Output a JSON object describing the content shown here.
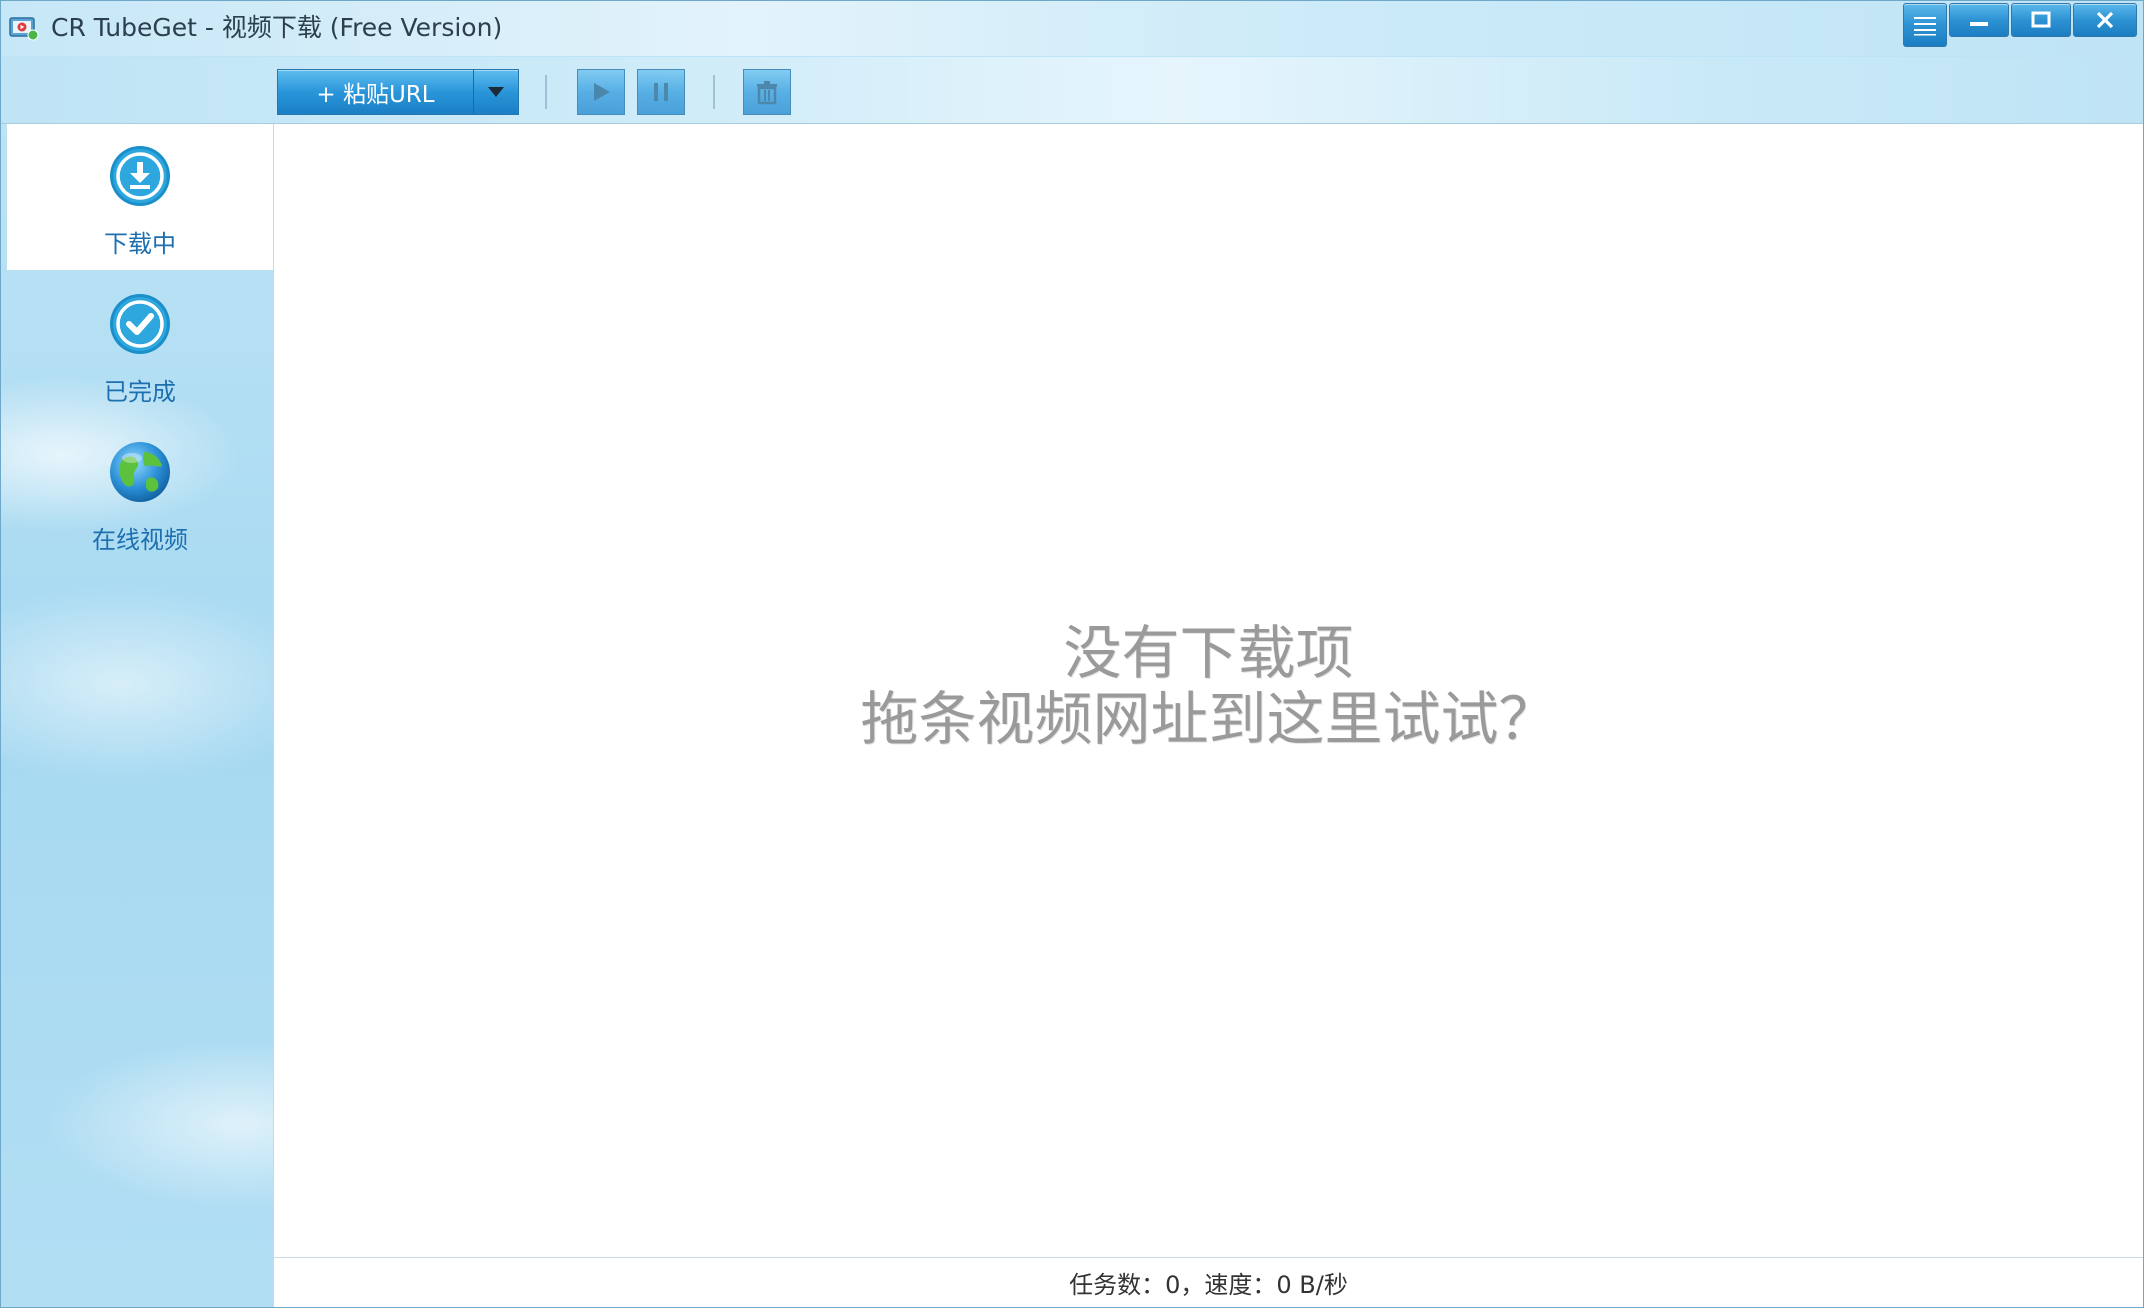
{
  "window": {
    "title": "CR TubeGet - 视频下载 (Free Version)",
    "controls": {
      "minimize": "—",
      "maximize": "▢",
      "close": "✕"
    }
  },
  "toolbar": {
    "paste_label": "+ 粘贴URL"
  },
  "sidebar": {
    "items": [
      {
        "label": "下载中",
        "icon": "download-icon",
        "active": true
      },
      {
        "label": "已完成",
        "icon": "check-icon",
        "active": false
      },
      {
        "label": "在线视频",
        "icon": "globe-icon",
        "active": false
      }
    ]
  },
  "main": {
    "empty_line1": "没有下载项",
    "empty_line2": "拖条视频网址到这里试试？"
  },
  "status": {
    "text": "任务数：0，速度：0 B/秒"
  },
  "colors": {
    "accent": "#2a95da",
    "nav_text": "#1e6fb0",
    "empty_text": "#9a9a9a"
  }
}
